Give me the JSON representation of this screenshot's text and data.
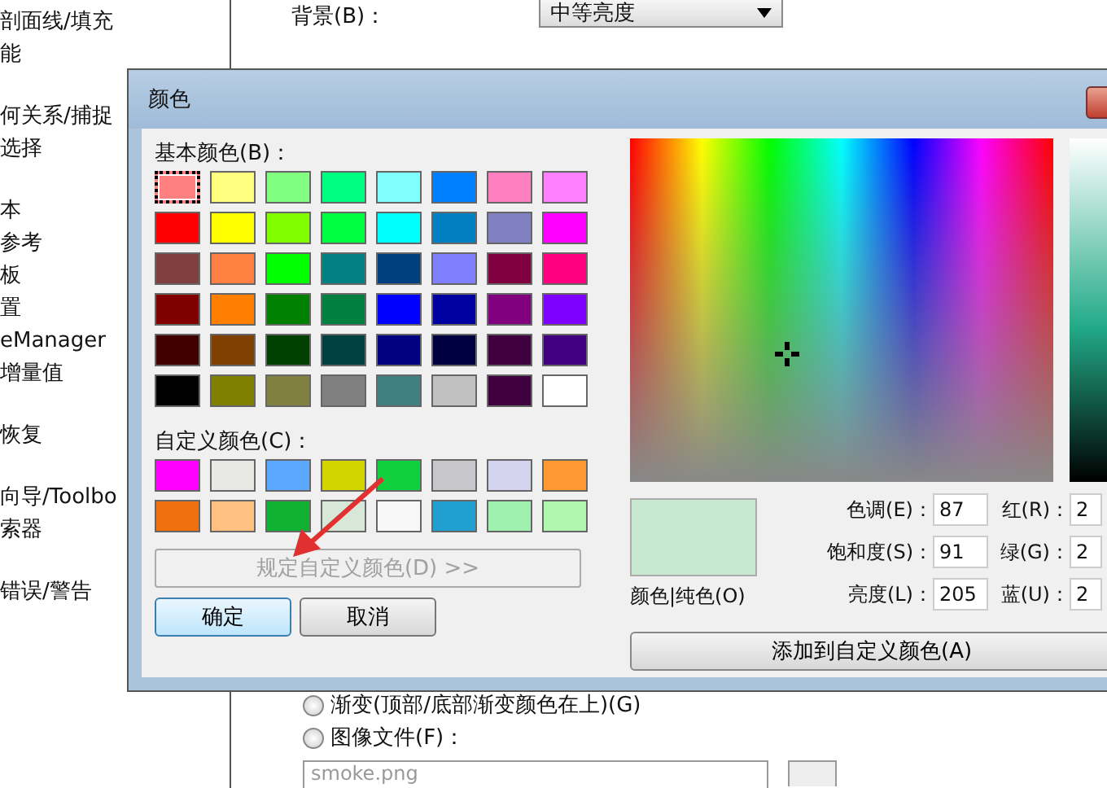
{
  "sidebar": {
    "items": [
      {
        "label": "剖面线/填充"
      },
      {
        "label": "能"
      },
      {
        "label": "何关系/捕捉"
      },
      {
        "label": "选择"
      },
      {
        "label": "本"
      },
      {
        "label": "参考"
      },
      {
        "label": "板"
      },
      {
        "label": "置"
      },
      {
        "label": "eManager"
      },
      {
        "label": "增量值"
      },
      {
        "label": "恢复"
      },
      {
        "label": "向导/Toolbo"
      },
      {
        "label": "索器"
      },
      {
        "label": "错误/警告"
      }
    ]
  },
  "background": {
    "label": "背景(B)：",
    "value": "中等亮度"
  },
  "fill_options": [
    {
      "label": "渐变(顶部/底部渐变颜色在上)(G)",
      "selected": false
    },
    {
      "label": "图像文件(F)：",
      "selected": false
    }
  ],
  "image_file": {
    "value": "smoke.png"
  },
  "dialog": {
    "title": "颜色",
    "basic_label": "基本颜色(B)：",
    "basic_colors": [
      {
        "color": "#ff8080",
        "selected": true
      },
      {
        "color": "#ffff80",
        "selected": false
      },
      {
        "color": "#80ff80",
        "selected": false
      },
      {
        "color": "#00ff80",
        "selected": false
      },
      {
        "color": "#80ffff",
        "selected": false
      },
      {
        "color": "#0080ff",
        "selected": false
      },
      {
        "color": "#ff80c0",
        "selected": false
      },
      {
        "color": "#ff80ff",
        "selected": false
      },
      {
        "color": "#ff0000",
        "selected": false
      },
      {
        "color": "#ffff00",
        "selected": false
      },
      {
        "color": "#80ff00",
        "selected": false
      },
      {
        "color": "#00ff40",
        "selected": false
      },
      {
        "color": "#00ffff",
        "selected": false
      },
      {
        "color": "#0080c0",
        "selected": false
      },
      {
        "color": "#8080c0",
        "selected": false
      },
      {
        "color": "#ff00ff",
        "selected": false
      },
      {
        "color": "#804040",
        "selected": false
      },
      {
        "color": "#ff8040",
        "selected": false
      },
      {
        "color": "#00ff00",
        "selected": false
      },
      {
        "color": "#008080",
        "selected": false
      },
      {
        "color": "#004080",
        "selected": false
      },
      {
        "color": "#8080ff",
        "selected": false
      },
      {
        "color": "#800040",
        "selected": false
      },
      {
        "color": "#ff0080",
        "selected": false
      },
      {
        "color": "#800000",
        "selected": false
      },
      {
        "color": "#ff8000",
        "selected": false
      },
      {
        "color": "#008000",
        "selected": false
      },
      {
        "color": "#008040",
        "selected": false
      },
      {
        "color": "#0000ff",
        "selected": false
      },
      {
        "color": "#0000a0",
        "selected": false
      },
      {
        "color": "#800080",
        "selected": false
      },
      {
        "color": "#8000ff",
        "selected": false
      },
      {
        "color": "#400000",
        "selected": false
      },
      {
        "color": "#804000",
        "selected": false
      },
      {
        "color": "#004000",
        "selected": false
      },
      {
        "color": "#004040",
        "selected": false
      },
      {
        "color": "#000080",
        "selected": false
      },
      {
        "color": "#000040",
        "selected": false
      },
      {
        "color": "#400040",
        "selected": false
      },
      {
        "color": "#400080",
        "selected": false
      },
      {
        "color": "#000000",
        "selected": false
      },
      {
        "color": "#808000",
        "selected": false
      },
      {
        "color": "#808040",
        "selected": false
      },
      {
        "color": "#808080",
        "selected": false
      },
      {
        "color": "#408080",
        "selected": false
      },
      {
        "color": "#c0c0c0",
        "selected": false
      },
      {
        "color": "#400040",
        "selected": false
      },
      {
        "color": "#ffffff",
        "selected": false
      }
    ],
    "custom_label": "自定义颜色(C)：",
    "custom_colors": [
      {
        "color": "#ff00ff",
        "selected": false
      },
      {
        "color": "#e8e8e4",
        "selected": false
      },
      {
        "color": "#5aa8ff",
        "selected": false
      },
      {
        "color": "#d4d400",
        "selected": false
      },
      {
        "color": "#10d040",
        "selected": false
      },
      {
        "color": "#c8c8cc",
        "selected": false
      },
      {
        "color": "#d4d4ee",
        "selected": false
      },
      {
        "color": "#ff9830",
        "selected": false
      },
      {
        "color": "#f07010",
        "selected": false
      },
      {
        "color": "#ffc080",
        "selected": false
      },
      {
        "color": "#10b030",
        "selected": false
      },
      {
        "color": "#d8e8d8",
        "selected": false
      },
      {
        "color": "#f8f8f8",
        "selected": false
      },
      {
        "color": "#20a0d0",
        "selected": false
      },
      {
        "color": "#a0f0b0",
        "selected": false
      },
      {
        "color": "#b0f8b0",
        "selected": false
      }
    ],
    "define_button": {
      "label": "规定自定义颜色(D) >>",
      "disabled": true
    },
    "ok_button": "确定",
    "cancel_button": "取消",
    "preview_label": "颜色|纯色(O)",
    "hsl_fields": [
      {
        "label": "色调(E)：",
        "value": "87"
      },
      {
        "label": "饱和度(S)：",
        "value": "91"
      },
      {
        "label": "亮度(L)：",
        "value": "205"
      }
    ],
    "rgb_fields": [
      {
        "label": "红(R)：",
        "value": "2"
      },
      {
        "label": "绿(G)：",
        "value": "2"
      },
      {
        "label": "蓝(U)：",
        "value": "2"
      }
    ],
    "add_button": "添加到自定义颜色(A)"
  }
}
